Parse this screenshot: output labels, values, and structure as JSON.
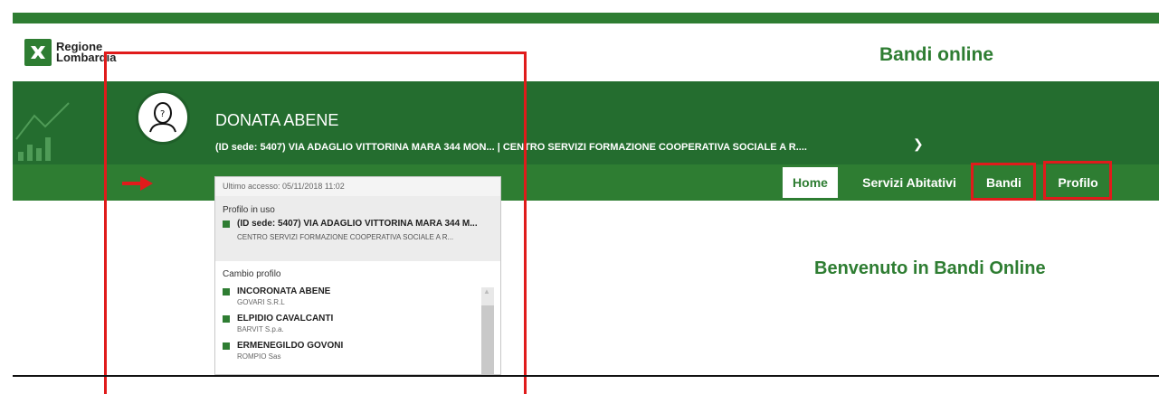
{
  "header": {
    "logo_line1": "Regione",
    "logo_line2": "Lombardia",
    "site_title": "Bandi online"
  },
  "user": {
    "name": "DONATA ABENE",
    "sede": "(ID sede: 5407) VIA ADAGLIO VITTORINA MARA 344 MON... | CENTRO SERVIZI FORMAZIONE COOPERATIVA SOCIALE A R....",
    "chevron": "❯"
  },
  "nav": {
    "home": "Home",
    "servizi": "Servizi Abitativi",
    "bandi": "Bandi",
    "profilo": "Profilo"
  },
  "dropdown": {
    "last_access": "Ultimo accesso: 05/11/2018 11:02",
    "current_title": "Profilo in uso",
    "current_main": "(ID sede: 5407) VIA ADAGLIO VITTORINA MARA 344 M...",
    "current_sub": "CENTRO SERVIZI FORMAZIONE COOPERATIVA SOCIALE A R...",
    "change_title": "Cambio profilo",
    "profiles": [
      {
        "name": "INCORONATA ABENE",
        "org": "GOVARI S.R.L"
      },
      {
        "name": "ELPIDIO CAVALCANTI",
        "org": "BARVIT S.p.a."
      },
      {
        "name": "ERMENEGILDO GOVONI",
        "org": "ROMPIO Sas"
      }
    ]
  },
  "main": {
    "welcome": "Benvenuto in Bandi Online"
  },
  "colors": {
    "brand": "#2e7d32",
    "banner": "#246d2f",
    "highlight": "#e01b1b"
  }
}
